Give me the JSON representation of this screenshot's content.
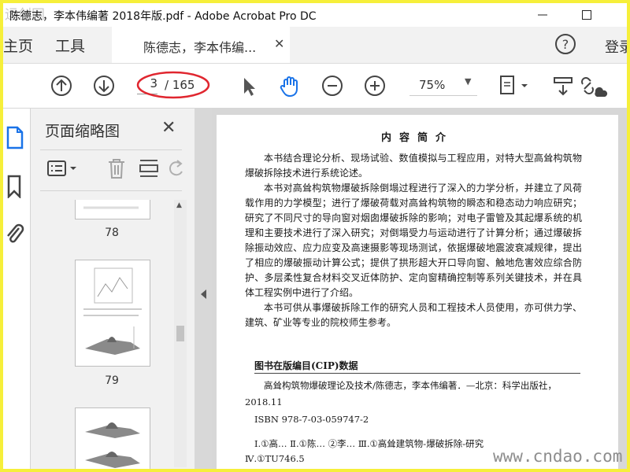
{
  "window": {
    "title": "陈德志，李本伟编著 2018年版.pdf - Adobe Acrobat Pro DC"
  },
  "tabs": {
    "home": "主页",
    "tools": "工具",
    "document": "陈德志，李本伟编...",
    "login": "登录"
  },
  "toolbar": {
    "current_page": "3",
    "total_pages": "/ 165",
    "zoom": "75%"
  },
  "thumbnails": {
    "title": "页面缩略图",
    "pages": [
      {
        "label": "78"
      },
      {
        "label": "79"
      }
    ]
  },
  "document": {
    "heading": "内容简介",
    "para1": "本书结合理论分析、现场试验、数值模拟与工程应用，对特大型高耸构筑物爆破拆除技术进行系统论述。",
    "para2": "本书对高耸构筑物爆破拆除倒塌过程进行了深入的力学分析，并建立了风荷载作用的力学模型；进行了爆破荷载对高耸构筑物的瞬态和稳态动力响应研究；研究了不同尺寸的导向窗对烟囱爆破拆除的影响；对电子雷管及其起爆系统的机理和主要技术进行了深入研究；对倒塌受力与运动进行了计算分析；通过爆破拆除振动效应、应力应变及高速摄影等现场测试，依据爆破地震波衰减规律，提出了相应的爆破振动计算公式；提供了拱形超大开口导向窗、触地危害效应综合防护、多层柔性复合材料交叉近体防护、定向窗精确控制等系列关键技术，并在具体工程实例中进行了介绍。",
    "para3": "本书可供从事爆破拆除工作的研究人员和工程技术人员使用，亦可供力学、建筑、矿业等专业的院校师生参考。",
    "cip_title": "图书在版编目(CIP)数据",
    "cip_line1": "高耸构筑物爆破理论及技术/陈德志，李本伟编著．—北京：科学出版社，",
    "cip_line2": "2018.11",
    "cip_line3": "ISBN 978-7-03-059747-2",
    "cip_line4": "Ⅰ.①高…  Ⅱ.①陈…  ②李…  Ⅲ.①高耸建筑物-爆破拆除-研究",
    "cip_line5": "Ⅳ.①TU746.5"
  },
  "watermark": "www.cndao.com",
  "colors": {
    "accent": "#1a73e8",
    "annotation": "#e0262f",
    "frame": "#f6ef3a"
  }
}
